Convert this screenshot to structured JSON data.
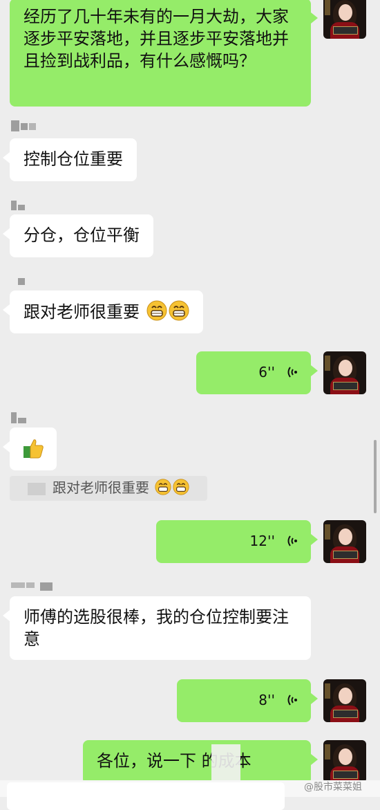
{
  "chat": {
    "messages": [
      {
        "text": "经历了几十年未有的一月大劫，大家逐步平安落地，并且逐步平安落地并且捡到战利品，有什么感慨吗？"
      },
      {
        "text": "控制仓位重要"
      },
      {
        "text": "分仓，仓位平衡"
      },
      {
        "text": "跟对老师很重要"
      },
      {
        "duration": "6''",
        "kind": "voice"
      },
      {
        "icon": "thumbs-up-emoji"
      },
      {
        "quote": "跟对老师很重要"
      },
      {
        "duration": "12''",
        "kind": "voice"
      },
      {
        "text": "师傅的选股很棒，我的仓位控制要注意"
      },
      {
        "duration": "8''",
        "kind": "voice"
      },
      {
        "text": "各位，说一下 的成本"
      }
    ]
  },
  "watermark": "@股市菜菜姐",
  "colors": {
    "background": "#ededed",
    "outgoing_bubble": "#95ec69",
    "incoming_bubble": "#ffffff"
  },
  "icons": [
    "grinning-emoji",
    "thumbs-up-emoji",
    "voice-wave-icon",
    "avatar"
  ]
}
